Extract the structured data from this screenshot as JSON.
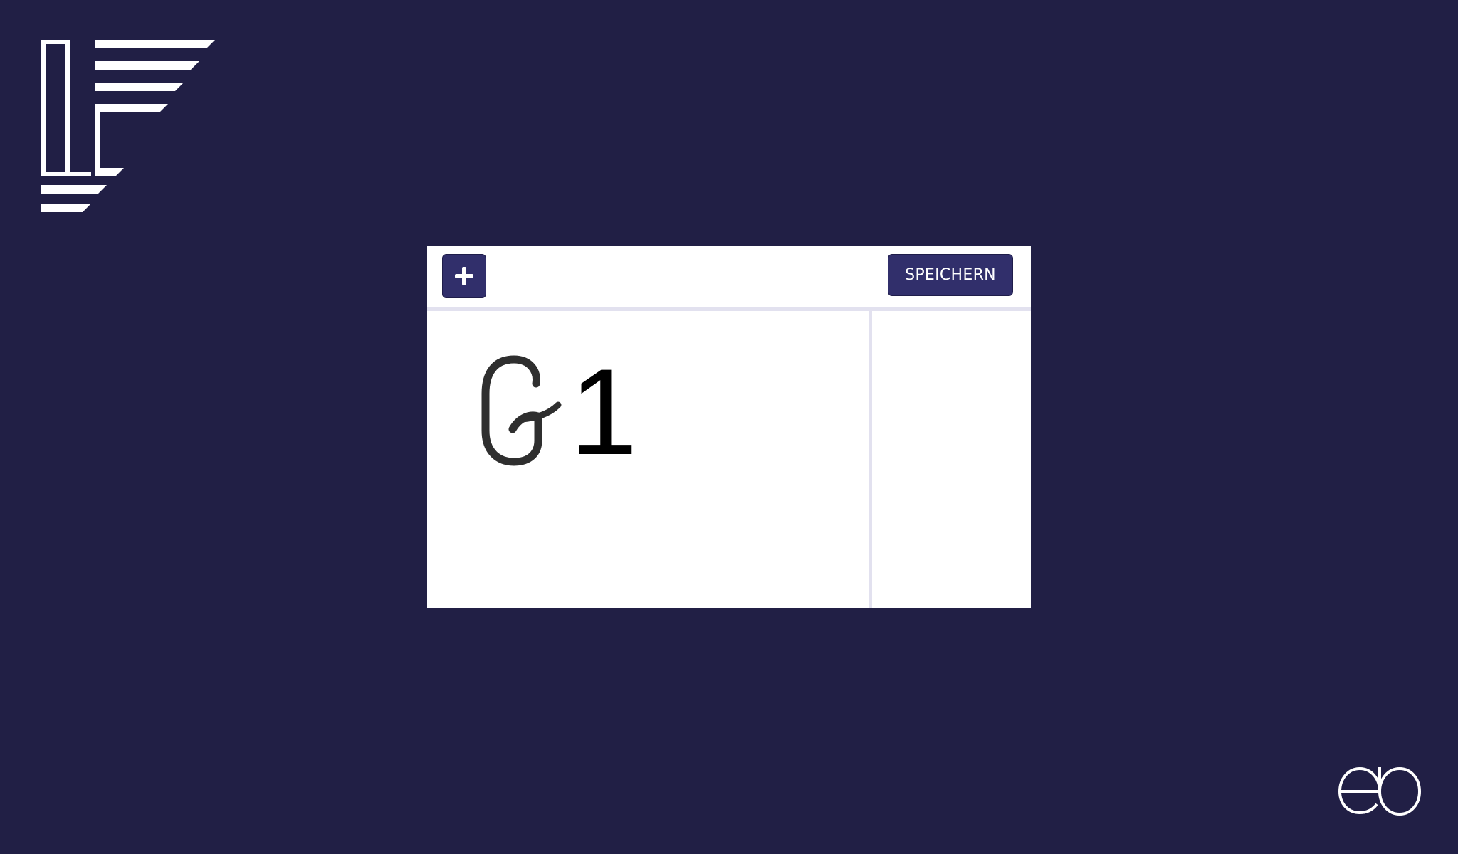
{
  "toolbar": {
    "add_icon": "plus-icon",
    "save_label": "SPEICHERN"
  },
  "canvas": {
    "handwritten_glyph": "G",
    "typed_glyph": "1",
    "ink_color": "#2f2f2f"
  },
  "colors": {
    "background": "#211f45",
    "button": "#312f6b",
    "divider": "#e2e1ef",
    "logo": "#ffffff"
  }
}
